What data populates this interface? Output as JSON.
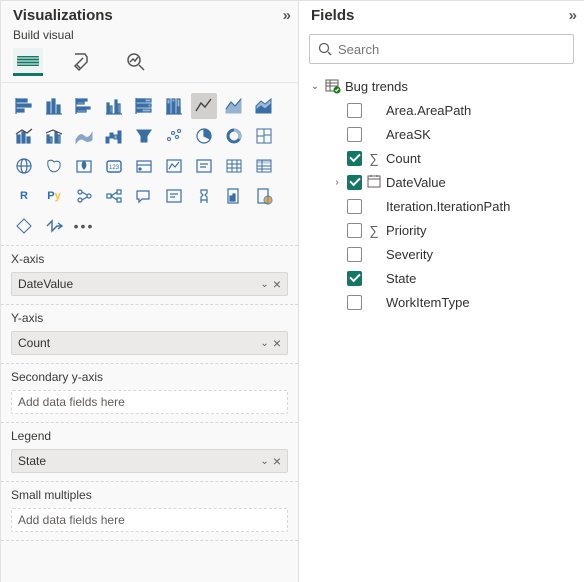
{
  "visualizations": {
    "title": "Visualizations",
    "subtitle": "Build visual",
    "wells": {
      "xaxis": {
        "label": "X-axis",
        "value": "DateValue"
      },
      "yaxis": {
        "label": "Y-axis",
        "value": "Count"
      },
      "secondary_y": {
        "label": "Secondary y-axis",
        "placeholder": "Add data fields here"
      },
      "legend": {
        "label": "Legend",
        "value": "State"
      },
      "small_multiples": {
        "label": "Small multiples",
        "placeholder": "Add data fields here"
      }
    }
  },
  "fields": {
    "title": "Fields",
    "search_placeholder": "Search",
    "table": {
      "name": "Bug trends"
    },
    "items": [
      {
        "label": "Area.AreaPath",
        "checked": false,
        "icon": ""
      },
      {
        "label": "AreaSK",
        "checked": false,
        "icon": ""
      },
      {
        "label": "Count",
        "checked": true,
        "icon": "sum"
      },
      {
        "label": "DateValue",
        "checked": true,
        "icon": "calendar",
        "expandable": true
      },
      {
        "label": "Iteration.IterationPath",
        "checked": false,
        "icon": ""
      },
      {
        "label": "Priority",
        "checked": false,
        "icon": "sum"
      },
      {
        "label": "Severity",
        "checked": false,
        "icon": ""
      },
      {
        "label": "State",
        "checked": true,
        "icon": ""
      },
      {
        "label": "WorkItemType",
        "checked": false,
        "icon": ""
      }
    ]
  }
}
